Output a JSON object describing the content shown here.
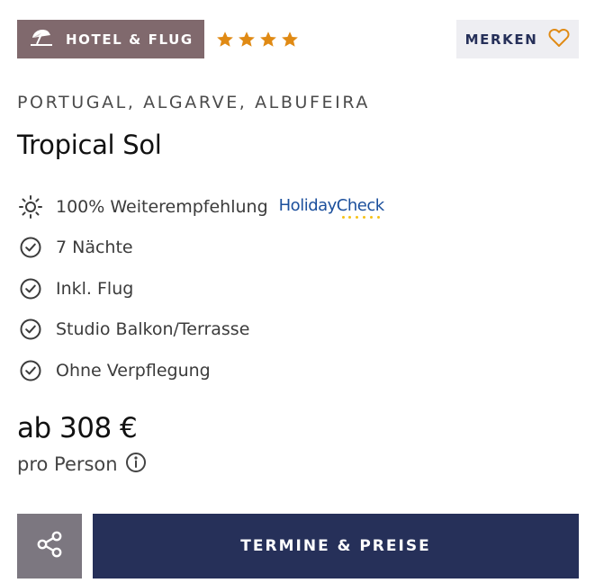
{
  "badge": {
    "label": "HOTEL & FLUG",
    "icon": "beach-umbrella-icon",
    "color": "#80696d"
  },
  "rating": {
    "stars": 4,
    "color": "#e08a14"
  },
  "bookmark": {
    "label": "MERKEN",
    "icon": "heart-outline-icon",
    "accent": "#e08a14"
  },
  "location": "PORTUGAL, ALGARVE, ALBUFEIRA",
  "hotel_name": "Tropical Sol",
  "features": [
    {
      "icon": "sun-icon",
      "text": "100% Weiterempfehlung",
      "brand": "HolidayCheck"
    },
    {
      "icon": "check-circle-icon",
      "text": "7 Nächte"
    },
    {
      "icon": "check-circle-icon",
      "text": "Inkl. Flug"
    },
    {
      "icon": "check-circle-icon",
      "text": "Studio Balkon/Terrasse"
    },
    {
      "icon": "check-circle-icon",
      "text": "Ohne Verpflegung"
    }
  ],
  "price": {
    "text": "ab 308 €",
    "unit": "pro Person",
    "info_icon": "info-icon"
  },
  "actions": {
    "share_icon": "share-icon",
    "cta_label": "TERMINE & PREISE",
    "cta_color": "#263059"
  }
}
